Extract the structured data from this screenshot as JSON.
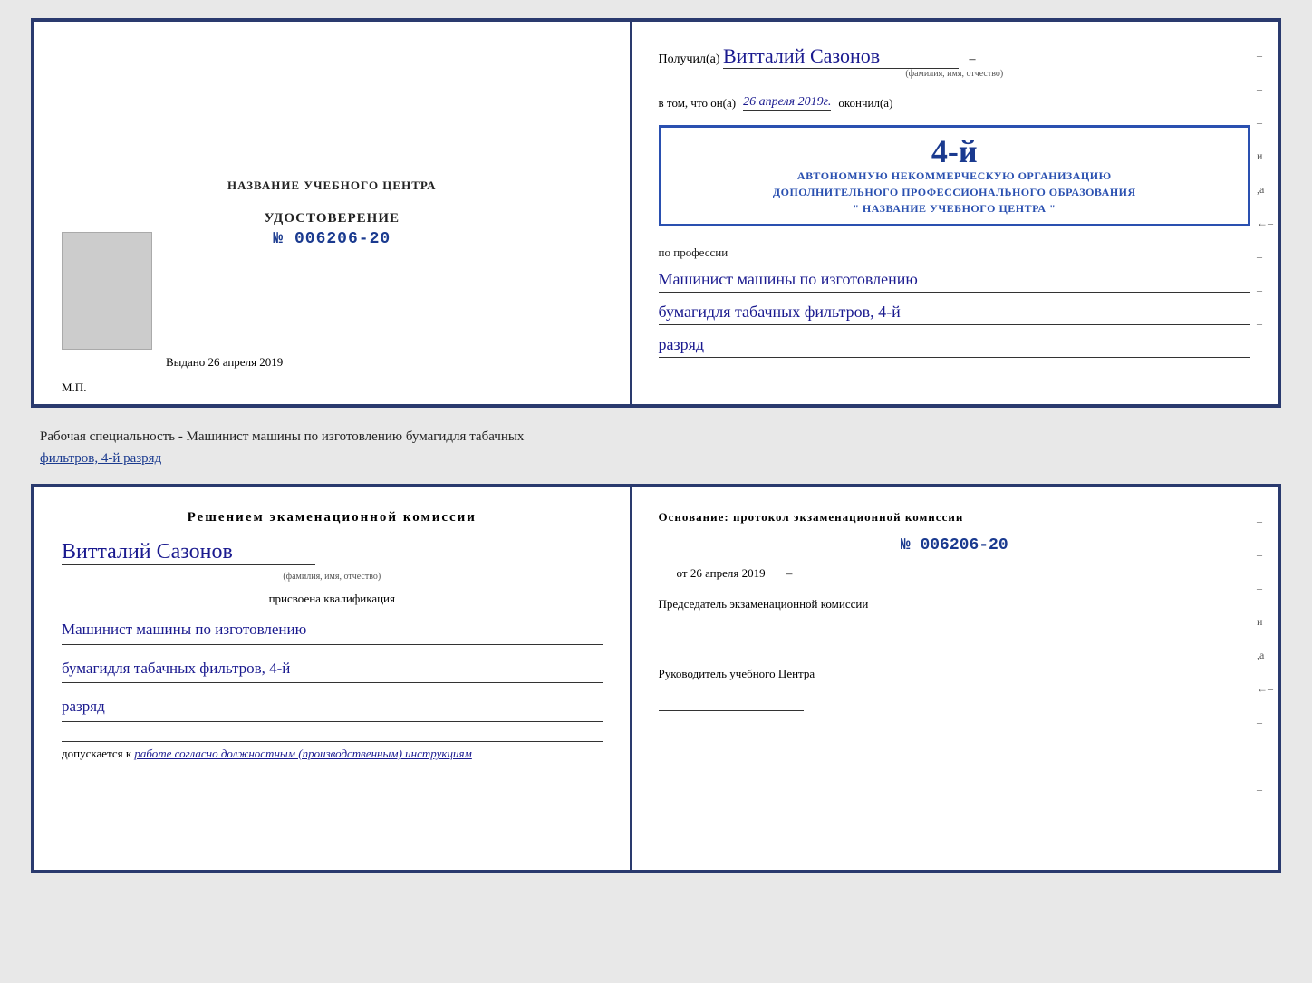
{
  "topCert": {
    "leftTitle": "НАЗВАНИЕ УЧЕБНОГО ЦЕНТРА",
    "udostLabel": "УДОСТОВЕРЕНИЕ",
    "udostNumber": "№ 006206-20",
    "vydanoLabel": "Выдано",
    "vydanoDate": "26 апреля 2019",
    "mpLabel": "М.П.",
    "poluchilLabel": "Получил(а)",
    "recipientName": "Витталий Сазонов",
    "fioSubLabel": "(фамилия, имя, отчество)",
    "vtomLabel": "в том, что он(а)",
    "vtomDate": "26 апреля 2019г.",
    "okonchilLabel": "окончил(а)",
    "stampLine1": "АВТОНОМНУЮ НЕКОММЕРЧЕСКУЮ ОРГАНИЗАЦИЮ",
    "stampLine2": "ДОПОЛНИТЕЛЬНОГО ПРОФЕССИОНАЛЬНОГО ОБРАЗОВАНИЯ",
    "stampLine3": "\" НАЗВАНИЕ УЧЕБНОГО ЦЕНТРА \"",
    "stampNum": "4-й",
    "professionLabel": "по профессии",
    "professionLine1": "Машинист машины по изготовлению",
    "professionLine2": "бумагидля табачных фильтров, 4-й",
    "professionLine3": "разряд",
    "dashes": [
      "-",
      "-",
      "-",
      "и",
      ",а",
      "←-",
      "-",
      "-",
      "-"
    ]
  },
  "middleText": {
    "main": "Рабочая специальность - Машинист машины по изготовлению бумагидля табачных",
    "underline": "фильтров, 4-й разряд"
  },
  "bottomCert": {
    "resheniemTitle": "Решением экаменационной комиссии",
    "fioName": "Витталий Сазонов",
    "fioSubLabel": "(фамилия, имя, отчество)",
    "prisvoenLabel": "присвоена квалификация",
    "qualLine1": "Машинист машины по изготовлению",
    "qualLine2": "бумагидля табачных фильтров, 4-й",
    "qualLine3": "разряд",
    "dopuskPrefix": "допускается к",
    "dopuskItalic": "работе согласно должностным (производственным) инструкциям",
    "osnovLabel": "Основание: протокол экзаменационной комиссии",
    "protocolNumber": "№ 006206-20",
    "otLabel": "от",
    "otDate": "26 апреля 2019",
    "predsedatelLabel": "Председатель экзаменационной комиссии",
    "rukovoditelLabel": "Руководитель учебного Центра",
    "dashes": [
      "-",
      "-",
      "-",
      "и",
      ",а",
      "←-",
      "-",
      "-",
      "-"
    ]
  }
}
